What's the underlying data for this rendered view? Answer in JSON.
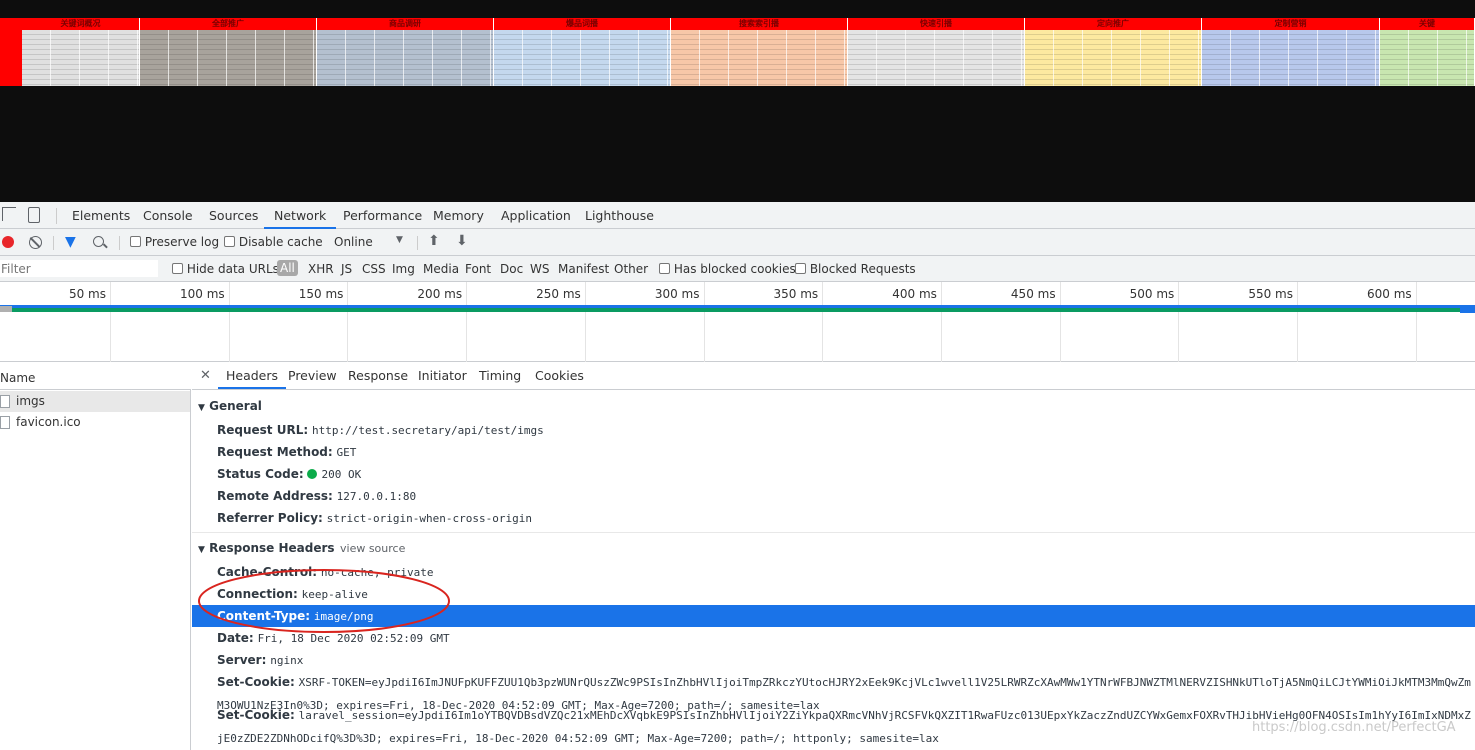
{
  "spreadsheet": {
    "sections": [
      {
        "title": "关键词概况",
        "color": "#e0e0e0"
      },
      {
        "title": "全部推广",
        "color": "#a8a39c"
      },
      {
        "title": "商品调研",
        "color": "#b4c0cf"
      },
      {
        "title": "爆品词播",
        "color": "#c4d8ee"
      },
      {
        "title": "搜索索引播",
        "color": "#f7c7a8"
      },
      {
        "title": "快速引播",
        "color": "#e4e4e4"
      },
      {
        "title": "定向推广",
        "color": "#fde9a0"
      },
      {
        "title": "定制营销",
        "color": "#b8c8ec"
      },
      {
        "title": "关键",
        "color": "#c8e6b0"
      }
    ]
  },
  "devtools": {
    "tabs": [
      "Elements",
      "Console",
      "Sources",
      "Network",
      "Performance",
      "Memory",
      "Application",
      "Lighthouse"
    ],
    "active_tab": "Network",
    "toolbar": {
      "preserve_log": "Preserve log",
      "disable_cache": "Disable cache",
      "throttle": "Online"
    },
    "filter": {
      "placeholder": "Filter",
      "hide_data_urls": "Hide data URLs",
      "types": [
        "All",
        "XHR",
        "JS",
        "CSS",
        "Img",
        "Media",
        "Font",
        "Doc",
        "WS",
        "Manifest",
        "Other"
      ],
      "has_blocked_cookies": "Has blocked cookies",
      "blocked_requests": "Blocked Requests"
    },
    "timeline_ticks": [
      "50 ms",
      "100 ms",
      "150 ms",
      "200 ms",
      "250 ms",
      "300 ms",
      "350 ms",
      "400 ms",
      "450 ms",
      "500 ms",
      "550 ms",
      "600 ms"
    ],
    "name_column": {
      "header": "Name",
      "requests": [
        "imgs",
        "favicon.ico"
      ]
    },
    "detail_tabs": [
      "Headers",
      "Preview",
      "Response",
      "Initiator",
      "Timing",
      "Cookies"
    ],
    "active_detail_tab": "Headers",
    "general": {
      "title": "General",
      "rows": [
        {
          "k": "Request URL:",
          "v": "http://test.secretary/api/test/imgs"
        },
        {
          "k": "Request Method:",
          "v": "GET"
        },
        {
          "k": "Status Code:",
          "v": "200 OK"
        },
        {
          "k": "Remote Address:",
          "v": "127.0.0.1:80"
        },
        {
          "k": "Referrer Policy:",
          "v": "strict-origin-when-cross-origin"
        }
      ]
    },
    "response_headers": {
      "title": "Response Headers",
      "view_source": "view source",
      "rows": [
        {
          "k": "Cache-Control:",
          "v": "no-cache, private"
        },
        {
          "k": "Connection:",
          "v": "keep-alive"
        },
        {
          "k": "Content-Type:",
          "v": "image/png"
        },
        {
          "k": "Date:",
          "v": "Fri, 18 Dec 2020 02:52:09 GMT"
        },
        {
          "k": "Server:",
          "v": "nginx"
        },
        {
          "k": "Set-Cookie:",
          "v": "XSRF-TOKEN=eyJpdiI6ImJNUFpKUFFZUU1Qb3pzWUNrQUszZWc9PSIsInZhbHVlIjoiTmpZRkczYUtocHJRY2xEek9KcjVLc1wvell1V25LRWRZcXAwMWw1YTNrWFBJNWZTMlNERVZISHNkUTloTjA5NmQiLCJtYWMiOiJkMTM3MmQwZmM3OWU1NzE3In0%3D; expires=Fri, 18-Dec-2020 04:52:09 GMT; Max-Age=7200; path=/; samesite=lax"
        },
        {
          "k": "Set-Cookie:",
          "v": "laravel_session=eyJpdiI6Im1oYTBQVDBsdVZQc21xMEhDcXVqbkE9PSIsInZhbHVlIjoiY2ZiYkpaQXRmcVNhVjRCSFVkQXZIT1RwaFUzc013UEpxYkZaczZndUZCYWxGemxFOXRvTHJibHVieHg0OFN4OSIsIm1hYyI6ImIxNDMxZjE0zZDE2ZDNhODcifQ%3D%3D; expires=Fri, 18-Dec-2020 04:52:09 GMT; Max-Age=7200; path=/; httponly; samesite=lax"
        }
      ]
    },
    "highlighted_row": "Content-Type:",
    "watermark": "https://blog.csdn.net/PerfectGA"
  }
}
